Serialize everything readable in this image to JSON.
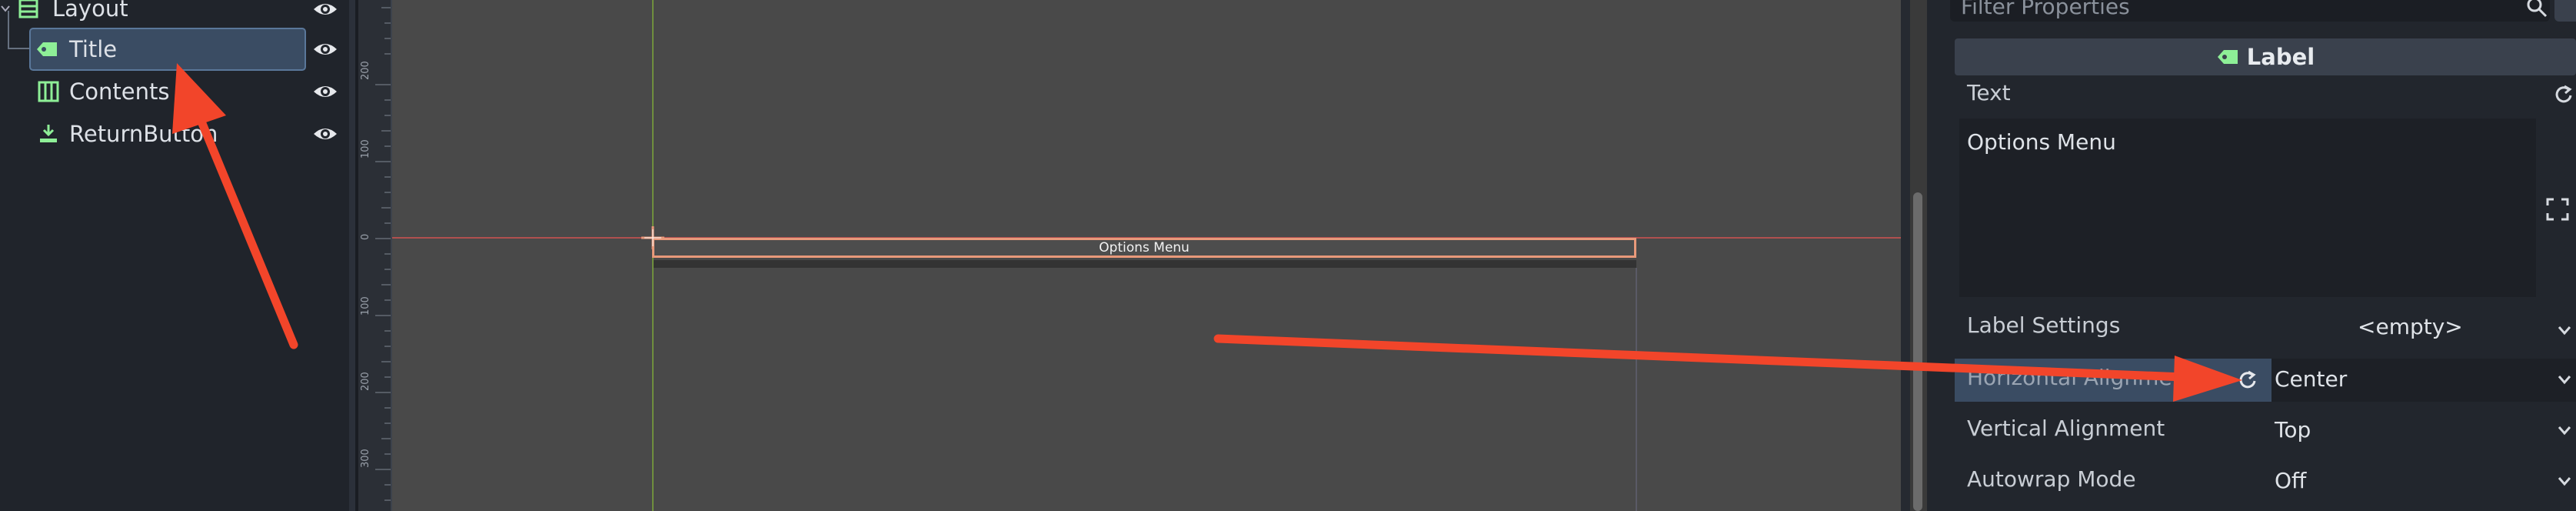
{
  "scene_tree": {
    "items": [
      {
        "label": "Layout",
        "icon": "vbox-icon"
      },
      {
        "label": "Title",
        "icon": "label-icon",
        "selected": true
      },
      {
        "label": "Contents",
        "icon": "grid-container-icon"
      },
      {
        "label": "ReturnButton",
        "icon": "button-icon"
      }
    ]
  },
  "viewport": {
    "ruler_ticks": [
      "200",
      "100",
      "0",
      "100",
      "200",
      "300"
    ],
    "label_text": "Options Menu"
  },
  "inspector": {
    "filter_placeholder": "Filter Properties",
    "section_title": "Label",
    "text_label": "Text",
    "text_value": "Options Menu",
    "label_settings_label": "Label Settings",
    "label_settings_value": "<empty>",
    "h_align_label": "Horizontal Alignment",
    "h_align_value": "Center",
    "v_align_label": "Vertical Alignment",
    "v_align_value": "Top",
    "autowrap_label": "Autowrap Mode",
    "autowrap_value": "Off"
  },
  "colors": {
    "accent_green": "#8eef97",
    "selection": "#3a4c63",
    "arrow": "#f2452a",
    "label_outline": "#e8997a"
  }
}
